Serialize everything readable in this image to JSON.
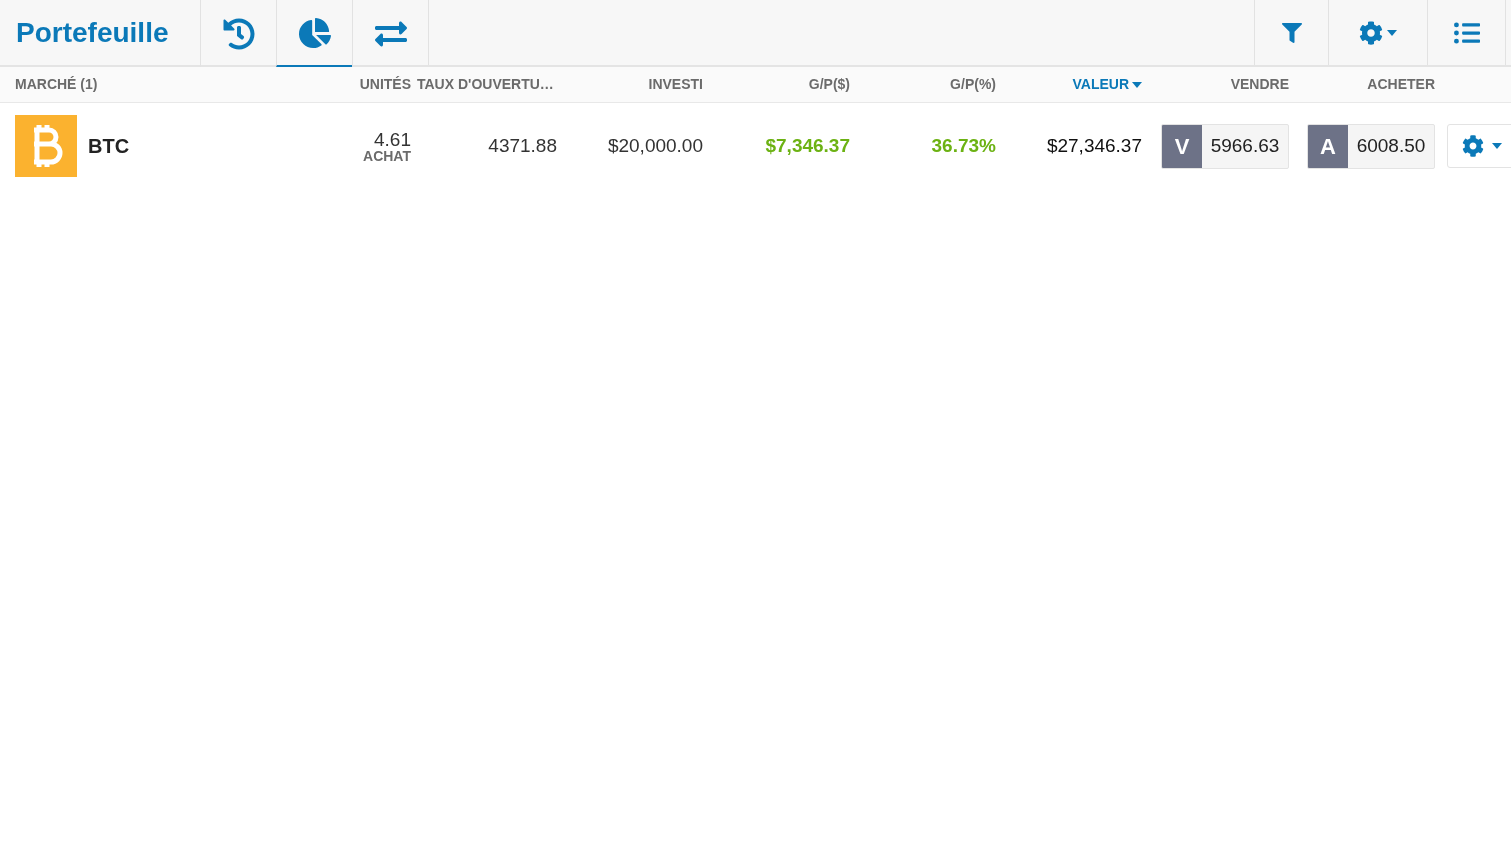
{
  "title": "Portefeuille",
  "tabs": [
    {
      "kind": "history",
      "selected": false
    },
    {
      "kind": "pie",
      "selected": true
    },
    {
      "kind": "transfer",
      "selected": false
    }
  ],
  "columns": [
    {
      "label": "MARCHÉ (1)",
      "sorted": false
    },
    {
      "label": "UNITÉS",
      "sorted": false
    },
    {
      "label": "TAUX D'OUVERTU…",
      "sorted": false
    },
    {
      "label": "INVESTI",
      "sorted": false
    },
    {
      "label": "G/P($)",
      "sorted": false
    },
    {
      "label": "G/P(%)",
      "sorted": false
    },
    {
      "label": "VALEUR",
      "sorted": true
    },
    {
      "label": "VENDRE",
      "sorted": false
    },
    {
      "label": "ACHETER",
      "sorted": false
    }
  ],
  "rows": [
    {
      "market": "BTC",
      "units": "4.61",
      "side": "ACHAT",
      "open_rate": "4371.88",
      "invested": "$20,000.00",
      "pl_amount": "$7,346.37",
      "pl_percent": "36.73%",
      "gain": true,
      "value": "$27,346.37",
      "sell_letter": "V",
      "sell_price": "5966.63",
      "buy_letter": "A",
      "buy_price": "6008.50"
    }
  ]
}
